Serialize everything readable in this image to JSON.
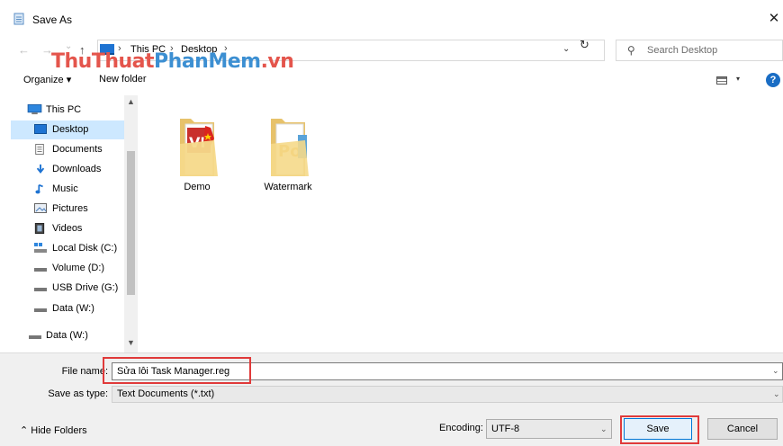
{
  "window": {
    "title": "Save As",
    "close_glyph": "✕"
  },
  "navigation": {
    "back_glyph": "←",
    "forward_glyph": "→",
    "recent_glyph": "⌄",
    "up_glyph": "↑",
    "breadcrumb": [
      "This PC",
      "Desktop"
    ],
    "separator_glyph": "›",
    "dropdown_glyph": "⌄",
    "refresh_glyph": "↻"
  },
  "search": {
    "placeholder": "Search Desktop",
    "icon": "search-icon"
  },
  "watermark": {
    "part1": "ThuThuat",
    "part2": "PhanMem",
    "part3": ".vn"
  },
  "toolbar": {
    "organize_label": "Organize ▾",
    "new_folder_label": "New folder",
    "view_caret": "▾",
    "help_label": "?"
  },
  "sidebar": {
    "items": [
      {
        "label": "This PC",
        "icon": "computer-icon",
        "selected": false
      },
      {
        "label": "Desktop",
        "icon": "desktop-icon",
        "selected": true
      },
      {
        "label": "Documents",
        "icon": "documents-icon",
        "selected": false
      },
      {
        "label": "Downloads",
        "icon": "downloads-icon",
        "selected": false
      },
      {
        "label": "Music",
        "icon": "music-icon",
        "selected": false
      },
      {
        "label": "Pictures",
        "icon": "pictures-icon",
        "selected": false
      },
      {
        "label": "Videos",
        "icon": "videos-icon",
        "selected": false
      },
      {
        "label": "Local Disk (C:)",
        "icon": "local-disk-icon",
        "selected": false
      },
      {
        "label": "Volume (D:)",
        "icon": "drive-icon",
        "selected": false
      },
      {
        "label": "USB Drive (G:)",
        "icon": "usb-drive-icon",
        "selected": false
      },
      {
        "label": "Data (W:)",
        "icon": "drive-icon",
        "selected": false
      },
      {
        "label": "Data (W:)",
        "icon": "drive-icon",
        "selected": false
      }
    ]
  },
  "files": [
    {
      "name": "Demo",
      "icon": "folder-icon"
    },
    {
      "name": "Watermark",
      "icon": "folder-icon"
    }
  ],
  "form": {
    "file_name_label": "File name:",
    "file_name_value": "Sửa lỗi Task Manager.reg",
    "save_as_type_label": "Save as type:",
    "save_as_type_value": "Text Documents (*.txt)",
    "caret_glyph": "⌄"
  },
  "footer": {
    "hide_folders_label": "⌃  Hide Folders",
    "encoding_label": "Encoding:",
    "encoding_value": "UTF-8",
    "save_label": "Save",
    "cancel_label": "Cancel"
  },
  "colors": {
    "selection": "#cde8ff",
    "highlight_box": "#e03a3a",
    "accent": "#0078d7"
  }
}
